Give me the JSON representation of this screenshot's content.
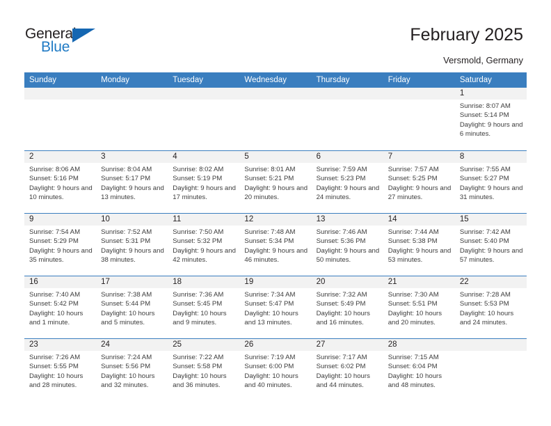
{
  "brand": {
    "name_top": "General",
    "name_bottom": "Blue",
    "accent_color": "#1567b2"
  },
  "header": {
    "title": "February 2025",
    "subtitle": "Versmold, Germany",
    "header_bg": "#3a7ebf",
    "numband_bg": "#f2f2f2"
  },
  "weekday_headers": [
    "Sunday",
    "Monday",
    "Tuesday",
    "Wednesday",
    "Thursday",
    "Friday",
    "Saturday"
  ],
  "weeks": [
    [
      {
        "day": "",
        "sunrise": "",
        "sunset": "",
        "daylight": "",
        "empty": true
      },
      {
        "day": "",
        "sunrise": "",
        "sunset": "",
        "daylight": "",
        "empty": true
      },
      {
        "day": "",
        "sunrise": "",
        "sunset": "",
        "daylight": "",
        "empty": true
      },
      {
        "day": "",
        "sunrise": "",
        "sunset": "",
        "daylight": "",
        "empty": true
      },
      {
        "day": "",
        "sunrise": "",
        "sunset": "",
        "daylight": "",
        "empty": true
      },
      {
        "day": "",
        "sunrise": "",
        "sunset": "",
        "daylight": "",
        "empty": true
      },
      {
        "day": "1",
        "sunrise": "Sunrise: 8:07 AM",
        "sunset": "Sunset: 5:14 PM",
        "daylight": "Daylight: 9 hours and 6 minutes.",
        "empty": false
      }
    ],
    [
      {
        "day": "2",
        "sunrise": "Sunrise: 8:06 AM",
        "sunset": "Sunset: 5:16 PM",
        "daylight": "Daylight: 9 hours and 10 minutes.",
        "empty": false
      },
      {
        "day": "3",
        "sunrise": "Sunrise: 8:04 AM",
        "sunset": "Sunset: 5:17 PM",
        "daylight": "Daylight: 9 hours and 13 minutes.",
        "empty": false
      },
      {
        "day": "4",
        "sunrise": "Sunrise: 8:02 AM",
        "sunset": "Sunset: 5:19 PM",
        "daylight": "Daylight: 9 hours and 17 minutes.",
        "empty": false
      },
      {
        "day": "5",
        "sunrise": "Sunrise: 8:01 AM",
        "sunset": "Sunset: 5:21 PM",
        "daylight": "Daylight: 9 hours and 20 minutes.",
        "empty": false
      },
      {
        "day": "6",
        "sunrise": "Sunrise: 7:59 AM",
        "sunset": "Sunset: 5:23 PM",
        "daylight": "Daylight: 9 hours and 24 minutes.",
        "empty": false
      },
      {
        "day": "7",
        "sunrise": "Sunrise: 7:57 AM",
        "sunset": "Sunset: 5:25 PM",
        "daylight": "Daylight: 9 hours and 27 minutes.",
        "empty": false
      },
      {
        "day": "8",
        "sunrise": "Sunrise: 7:55 AM",
        "sunset": "Sunset: 5:27 PM",
        "daylight": "Daylight: 9 hours and 31 minutes.",
        "empty": false
      }
    ],
    [
      {
        "day": "9",
        "sunrise": "Sunrise: 7:54 AM",
        "sunset": "Sunset: 5:29 PM",
        "daylight": "Daylight: 9 hours and 35 minutes.",
        "empty": false
      },
      {
        "day": "10",
        "sunrise": "Sunrise: 7:52 AM",
        "sunset": "Sunset: 5:31 PM",
        "daylight": "Daylight: 9 hours and 38 minutes.",
        "empty": false
      },
      {
        "day": "11",
        "sunrise": "Sunrise: 7:50 AM",
        "sunset": "Sunset: 5:32 PM",
        "daylight": "Daylight: 9 hours and 42 minutes.",
        "empty": false
      },
      {
        "day": "12",
        "sunrise": "Sunrise: 7:48 AM",
        "sunset": "Sunset: 5:34 PM",
        "daylight": "Daylight: 9 hours and 46 minutes.",
        "empty": false
      },
      {
        "day": "13",
        "sunrise": "Sunrise: 7:46 AM",
        "sunset": "Sunset: 5:36 PM",
        "daylight": "Daylight: 9 hours and 50 minutes.",
        "empty": false
      },
      {
        "day": "14",
        "sunrise": "Sunrise: 7:44 AM",
        "sunset": "Sunset: 5:38 PM",
        "daylight": "Daylight: 9 hours and 53 minutes.",
        "empty": false
      },
      {
        "day": "15",
        "sunrise": "Sunrise: 7:42 AM",
        "sunset": "Sunset: 5:40 PM",
        "daylight": "Daylight: 9 hours and 57 minutes.",
        "empty": false
      }
    ],
    [
      {
        "day": "16",
        "sunrise": "Sunrise: 7:40 AM",
        "sunset": "Sunset: 5:42 PM",
        "daylight": "Daylight: 10 hours and 1 minute.",
        "empty": false
      },
      {
        "day": "17",
        "sunrise": "Sunrise: 7:38 AM",
        "sunset": "Sunset: 5:44 PM",
        "daylight": "Daylight: 10 hours and 5 minutes.",
        "empty": false
      },
      {
        "day": "18",
        "sunrise": "Sunrise: 7:36 AM",
        "sunset": "Sunset: 5:45 PM",
        "daylight": "Daylight: 10 hours and 9 minutes.",
        "empty": false
      },
      {
        "day": "19",
        "sunrise": "Sunrise: 7:34 AM",
        "sunset": "Sunset: 5:47 PM",
        "daylight": "Daylight: 10 hours and 13 minutes.",
        "empty": false
      },
      {
        "day": "20",
        "sunrise": "Sunrise: 7:32 AM",
        "sunset": "Sunset: 5:49 PM",
        "daylight": "Daylight: 10 hours and 16 minutes.",
        "empty": false
      },
      {
        "day": "21",
        "sunrise": "Sunrise: 7:30 AM",
        "sunset": "Sunset: 5:51 PM",
        "daylight": "Daylight: 10 hours and 20 minutes.",
        "empty": false
      },
      {
        "day": "22",
        "sunrise": "Sunrise: 7:28 AM",
        "sunset": "Sunset: 5:53 PM",
        "daylight": "Daylight: 10 hours and 24 minutes.",
        "empty": false
      }
    ],
    [
      {
        "day": "23",
        "sunrise": "Sunrise: 7:26 AM",
        "sunset": "Sunset: 5:55 PM",
        "daylight": "Daylight: 10 hours and 28 minutes.",
        "empty": false
      },
      {
        "day": "24",
        "sunrise": "Sunrise: 7:24 AM",
        "sunset": "Sunset: 5:56 PM",
        "daylight": "Daylight: 10 hours and 32 minutes.",
        "empty": false
      },
      {
        "day": "25",
        "sunrise": "Sunrise: 7:22 AM",
        "sunset": "Sunset: 5:58 PM",
        "daylight": "Daylight: 10 hours and 36 minutes.",
        "empty": false
      },
      {
        "day": "26",
        "sunrise": "Sunrise: 7:19 AM",
        "sunset": "Sunset: 6:00 PM",
        "daylight": "Daylight: 10 hours and 40 minutes.",
        "empty": false
      },
      {
        "day": "27",
        "sunrise": "Sunrise: 7:17 AM",
        "sunset": "Sunset: 6:02 PM",
        "daylight": "Daylight: 10 hours and 44 minutes.",
        "empty": false
      },
      {
        "day": "28",
        "sunrise": "Sunrise: 7:15 AM",
        "sunset": "Sunset: 6:04 PM",
        "daylight": "Daylight: 10 hours and 48 minutes.",
        "empty": false
      },
      {
        "day": "",
        "sunrise": "",
        "sunset": "",
        "daylight": "",
        "empty": true
      }
    ]
  ]
}
